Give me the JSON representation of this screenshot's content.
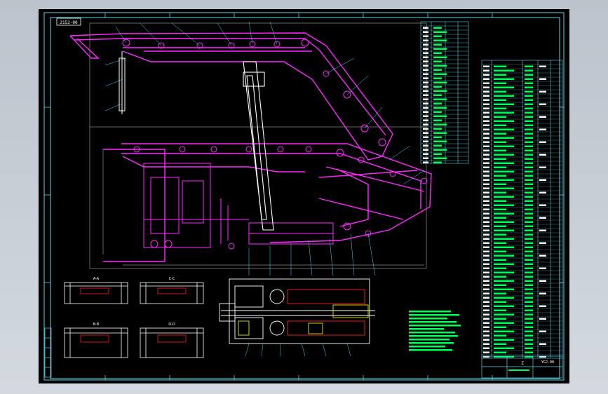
{
  "drawing": {
    "section_labels": [
      "A-A",
      "C-C",
      "B-B",
      "D-D"
    ],
    "title_block_code": "Z",
    "drawing_number": "YGJ-00",
    "top_left_tag": "2152-00"
  },
  "colors": {
    "viewer_bg": "#c9ced6",
    "sheet_bg": "#000000",
    "frame": "#5fd3e6",
    "part_magenta": "#ff28ff",
    "part_white": "#ffffff",
    "leader_cyan": "#37e0ff",
    "notes_green": "#00ff55",
    "detail_red": "#ff2020",
    "detail_yellow": "#e8e800"
  }
}
